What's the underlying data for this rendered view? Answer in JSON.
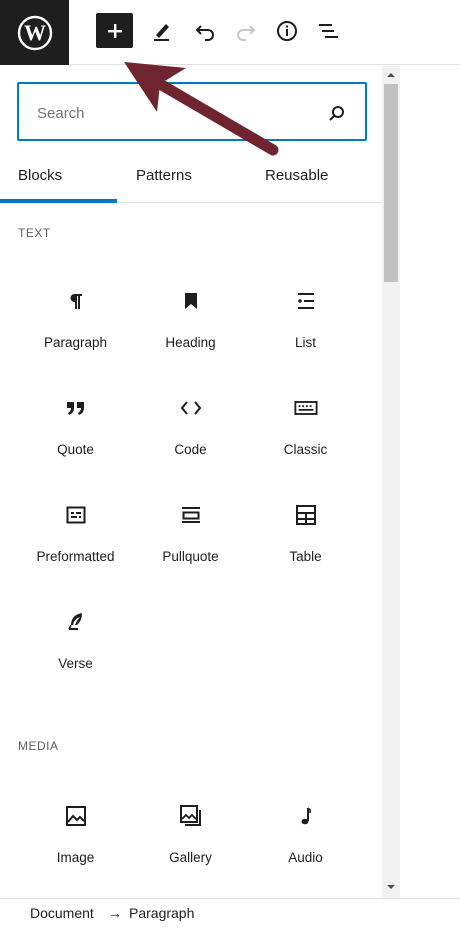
{
  "toolbar": {
    "buttons": [
      {
        "name": "inserter-plus-icon"
      },
      {
        "name": "edit-pencil-icon"
      },
      {
        "name": "undo-icon"
      },
      {
        "name": "redo-icon"
      },
      {
        "name": "info-icon"
      },
      {
        "name": "list-view-icon"
      }
    ]
  },
  "search": {
    "placeholder": "Search"
  },
  "tabs": [
    "Blocks",
    "Patterns",
    "Reusable"
  ],
  "sections": {
    "text": {
      "title": "TEXT",
      "items": [
        {
          "label": "Paragraph",
          "icon": "paragraph-icon"
        },
        {
          "label": "Heading",
          "icon": "bookmark-icon"
        },
        {
          "label": "List",
          "icon": "list-icon"
        },
        {
          "label": "Quote",
          "icon": "quote-icon"
        },
        {
          "label": "Code",
          "icon": "code-icon"
        },
        {
          "label": "Classic",
          "icon": "keyboard-icon"
        },
        {
          "label": "Preformatted",
          "icon": "preformatted-icon"
        },
        {
          "label": "Pullquote",
          "icon": "pullquote-icon"
        },
        {
          "label": "Table",
          "icon": "table-icon"
        },
        {
          "label": "Verse",
          "icon": "feather-icon"
        }
      ]
    },
    "media": {
      "title": "MEDIA",
      "items": [
        {
          "label": "Image",
          "icon": "image-icon"
        },
        {
          "label": "Gallery",
          "icon": "gallery-icon"
        },
        {
          "label": "Audio",
          "icon": "audio-icon"
        }
      ]
    }
  },
  "breadcrumb": {
    "root": "Document",
    "separator": "→",
    "current": "Paragraph"
  },
  "colors": {
    "accent": "#007cba",
    "dark": "#1e1e1e",
    "annotation_arrow": "#6e2530"
  }
}
